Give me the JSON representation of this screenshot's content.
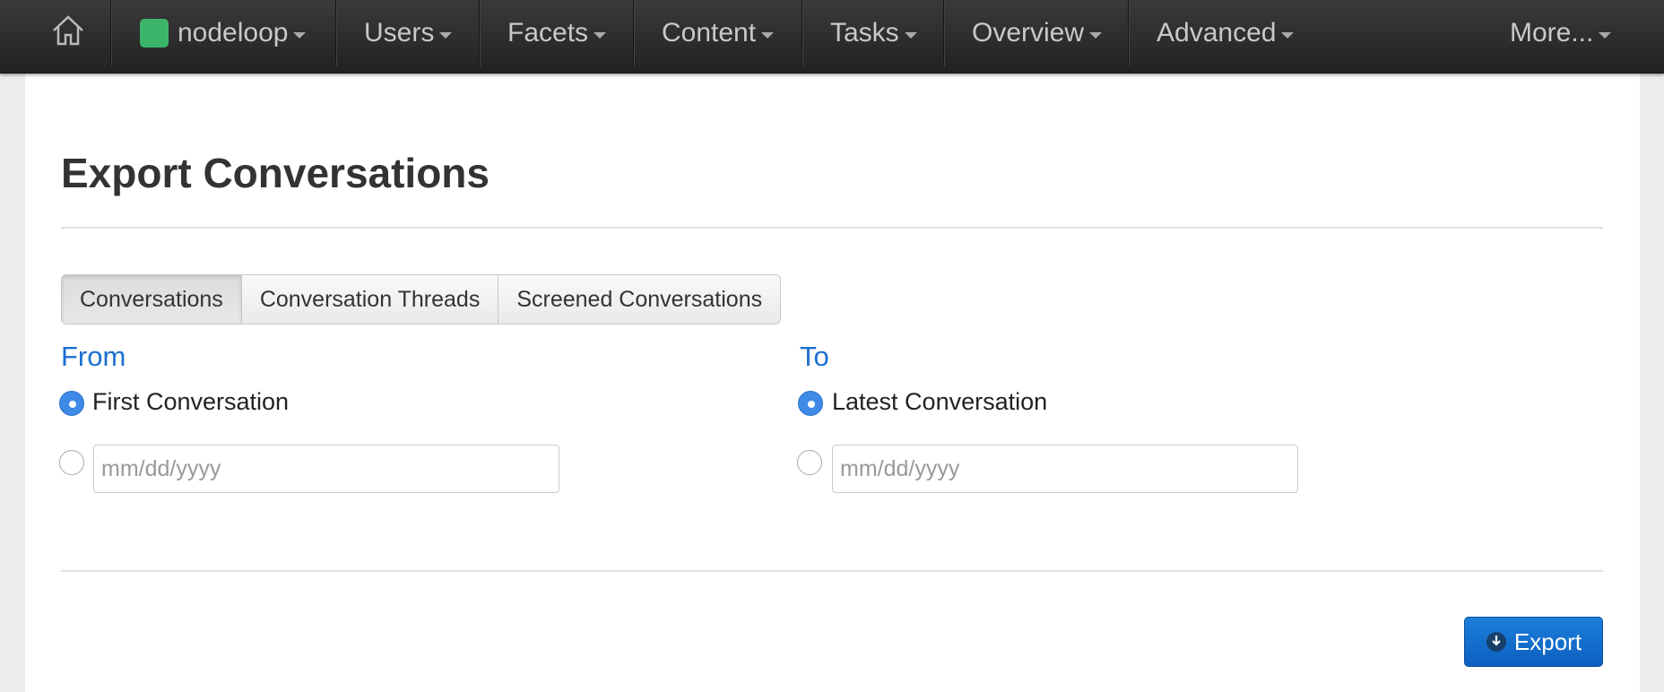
{
  "nav": {
    "brand": "nodeloop",
    "brand_color": "#3cb56b",
    "items": [
      "Users",
      "Facets",
      "Content",
      "Tasks",
      "Overview",
      "Advanced"
    ],
    "more": "More..."
  },
  "page": {
    "title": "Export Conversations",
    "tabs": [
      "Conversations",
      "Conversation Threads",
      "Screened Conversations"
    ],
    "active_tab": "Conversations"
  },
  "from": {
    "label": "From",
    "option_label": "First Conversation",
    "date_placeholder": "mm/dd/yyyy"
  },
  "to": {
    "label": "To",
    "option_label": "Latest Conversation",
    "date_placeholder": "mm/dd/yyyy"
  },
  "actions": {
    "export_label": "Export"
  },
  "colors": {
    "accent": "#1b6fd1",
    "export_button": "#0d6ad0"
  }
}
